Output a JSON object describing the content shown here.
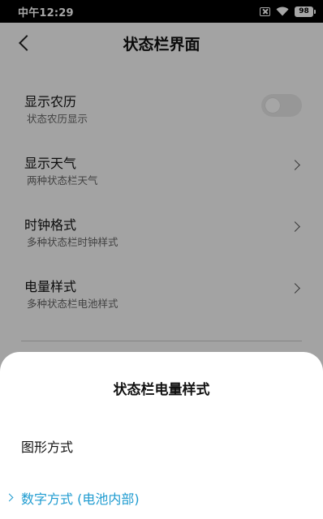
{
  "status_bar": {
    "time": "中午12:29",
    "battery": "98"
  },
  "header": {
    "title": "状态栏界面"
  },
  "settings": {
    "items": [
      {
        "label": "显示农历",
        "subtitle": "状态农历显示",
        "control": "toggle",
        "enabled": false
      },
      {
        "label": "显示天气",
        "subtitle": "两种状态栏天气",
        "control": "chevron"
      },
      {
        "label": "时钟格式",
        "subtitle": "多种状态栏时钟样式",
        "control": "chevron"
      },
      {
        "label": "电量样式",
        "subtitle": "多种状态栏电池样式",
        "control": "chevron"
      }
    ]
  },
  "sheet": {
    "title": "状态栏电量样式",
    "options": [
      {
        "label": "图形方式",
        "selected": false
      },
      {
        "label": "数字方式 (电池内部)",
        "selected": true
      }
    ],
    "accent": "#1e9bd0"
  }
}
